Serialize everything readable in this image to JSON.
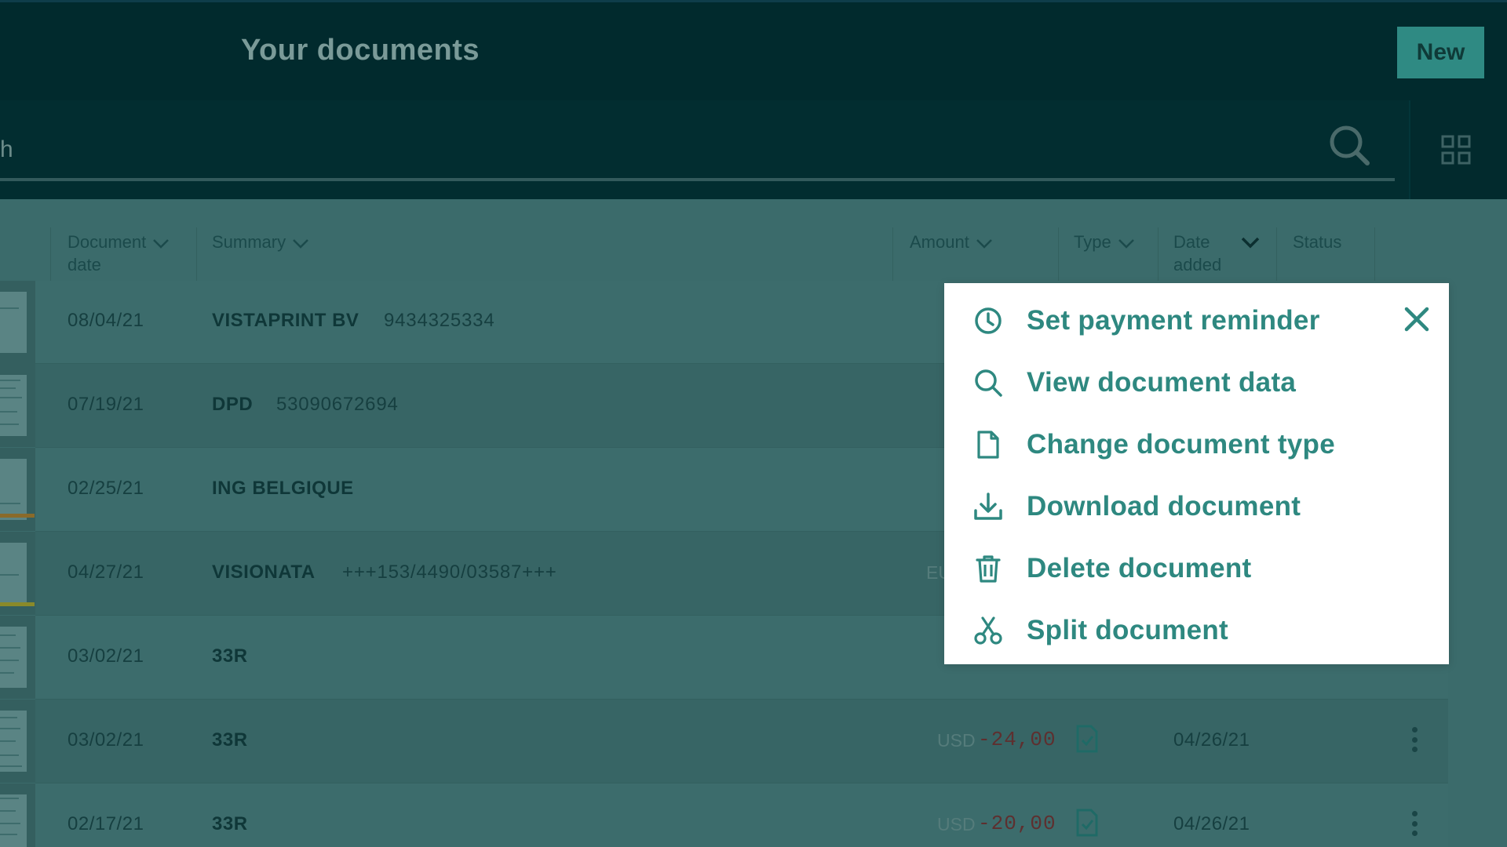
{
  "header": {
    "title": "Your documents",
    "new_button_label": "New"
  },
  "search": {
    "visible_text": "h"
  },
  "table": {
    "columns": [
      {
        "label_line1": "Document",
        "label_line2": "date"
      },
      {
        "label_line1": "Summary",
        "label_line2": ""
      },
      {
        "label_line1": "Amount",
        "label_line2": ""
      },
      {
        "label_line1": "Type",
        "label_line2": ""
      },
      {
        "label_line1": "Date",
        "label_line2": "added"
      },
      {
        "label_line1": "Status",
        "label_line2": ""
      }
    ],
    "rows": [
      {
        "date": "08/04/21",
        "vendor": "VISTAPRINT BV",
        "reference": "9434325334",
        "currency": "",
        "amount": "",
        "date_added": ""
      },
      {
        "date": "07/19/21",
        "vendor": "DPD",
        "reference": "53090672694",
        "currency": "",
        "amount": "",
        "date_added": ""
      },
      {
        "date": "02/25/21",
        "vendor": "ING BELGIQUE",
        "reference": "",
        "currency": "",
        "amount": "",
        "date_added": ""
      },
      {
        "date": "04/27/21",
        "vendor": "VISIONATA",
        "reference": "+++153/4490/03587+++",
        "currency": "EU",
        "amount": "",
        "date_added": ""
      },
      {
        "date": "03/02/21",
        "vendor": "33R",
        "reference": "",
        "currency": "",
        "amount": "",
        "date_added": ""
      },
      {
        "date": "03/02/21",
        "vendor": "33R",
        "reference": "",
        "currency": "USD",
        "amount": "-24,00",
        "date_added": "04/26/21"
      },
      {
        "date": "02/17/21",
        "vendor": "33R",
        "reference": "",
        "currency": "USD",
        "amount": "-20,00",
        "date_added": "04/26/21"
      }
    ]
  },
  "context_menu": {
    "items": [
      {
        "label": "Set payment reminder",
        "icon": "clock-icon"
      },
      {
        "label": "View document data",
        "icon": "search-icon"
      },
      {
        "label": "Change document type",
        "icon": "document-icon"
      },
      {
        "label": "Download document",
        "icon": "download-icon"
      },
      {
        "label": "Delete document",
        "icon": "trash-icon"
      },
      {
        "label": "Split document",
        "icon": "scissors-icon"
      }
    ],
    "close_icon": "close-icon"
  },
  "colors": {
    "menu_accent": "#2e8880",
    "topbar": "#012a2d",
    "overlay_table": "#3b6b6b",
    "negative_amount": "#5e2f2f"
  }
}
